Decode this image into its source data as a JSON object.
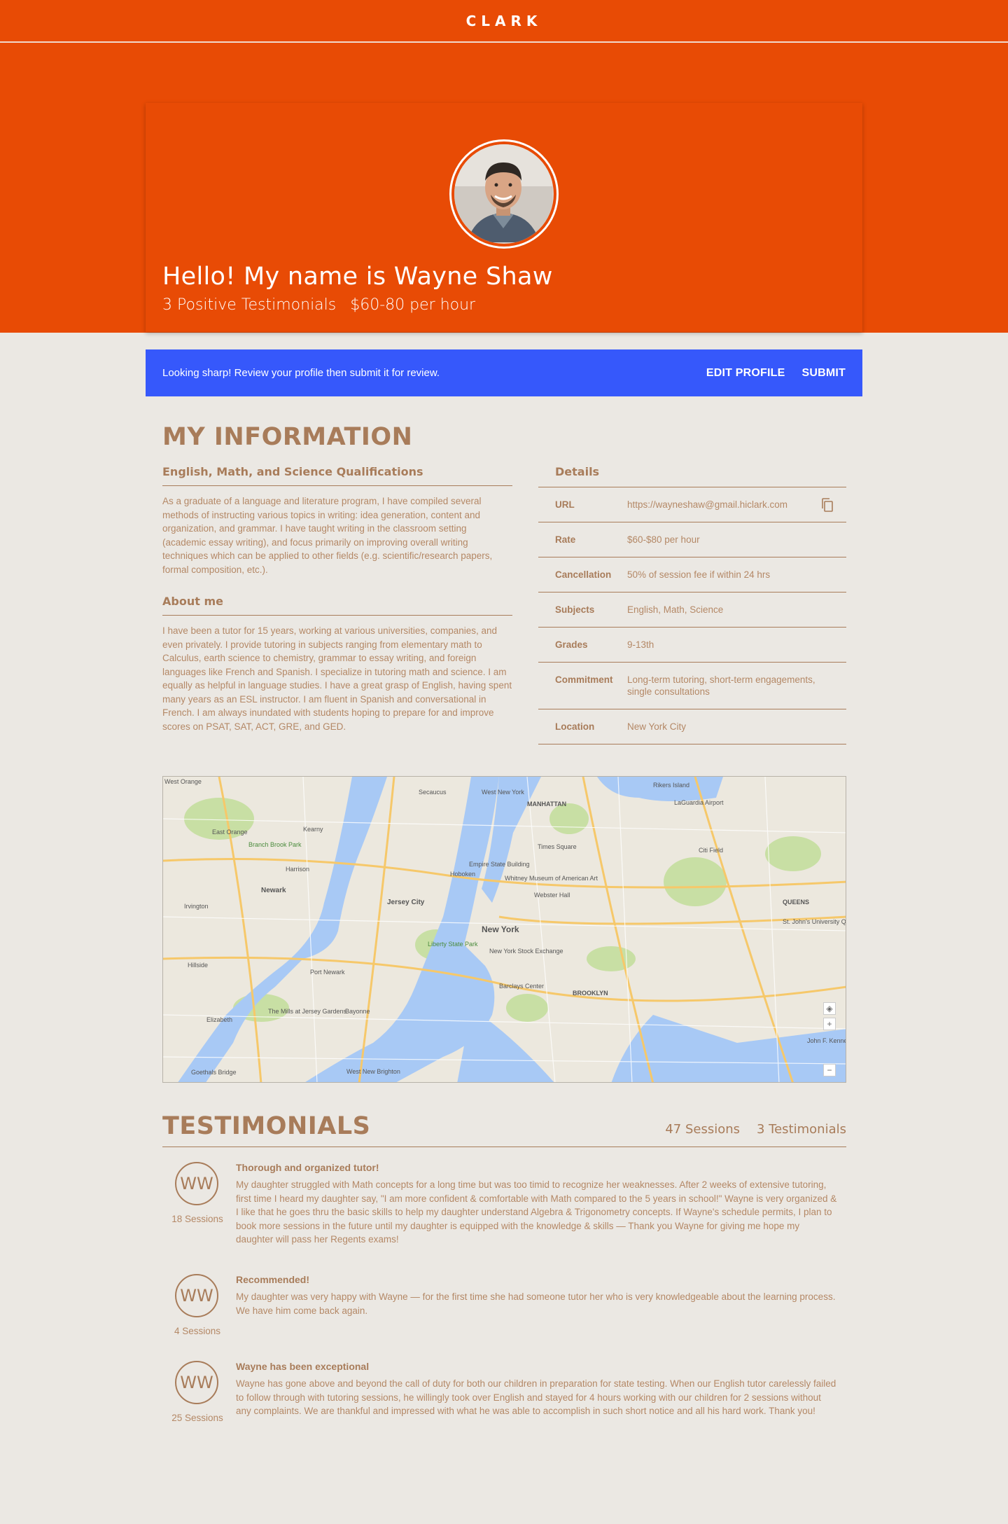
{
  "header": {
    "logo": "CLARK"
  },
  "hero": {
    "greeting": "Hello! My name is Wayne Shaw",
    "testimonials": "3 Positive Testimonials",
    "rate": "$60-80 per hour"
  },
  "banner": {
    "message": "Looking sharp! Review your profile then submit it for review.",
    "edit_label": "EDIT PROFILE",
    "submit_label": "SUBMIT",
    "color": "#3658fb"
  },
  "info": {
    "title": "MY INFORMATION",
    "qualifications_title": "English, Math, and Science Qualifications",
    "qualifications_text": "As a graduate of a language and literature program, I have compiled several methods of instructing various topics in writing: idea generation, content and organization, and grammar. I have taught writing in the classroom setting (academic essay writing), and focus primarily on improving overall writing techniques which can be applied to other fields (e.g. scientific/research papers, formal composition, etc.).",
    "about_title": "About me",
    "about_text": "I have been a tutor for 15 years, working at various universities, companies, and even privately. I provide tutoring in subjects ranging from elementary math to Calculus, earth science to chemistry, grammar to essay writing, and foreign languages like French and Spanish. I specialize in tutoring math and science. I am equally as helpful in language studies. I have a great grasp of English, having spent many years as an ESL instructor. I am fluent in Spanish and conversational in French. I am always inundated with students hoping to prepare for and improve scores on PSAT, SAT, ACT, GRE, and GED.",
    "details_title": "Details",
    "details": [
      {
        "key": "URL",
        "value": "https://wayneshaw@gmail.hiclark.com"
      },
      {
        "key": "Rate",
        "value": "$60-$80 per hour"
      },
      {
        "key": "Cancellation",
        "value": "50% of session fee if within 24 hrs"
      },
      {
        "key": "Subjects",
        "value": "English, Math, Science"
      },
      {
        "key": "Grades",
        "value": "9-13th"
      },
      {
        "key": "Commitment",
        "value": "Long-term tutoring, short-term engagements, single consultations"
      },
      {
        "key": "Location",
        "value": "New York City"
      }
    ]
  },
  "map": {
    "labels": [
      "West Orange",
      "Secaucus",
      "West New York",
      "MANHATTAN",
      "Rikers Island",
      "LaGuardia Airport",
      "East Orange",
      "Kearny",
      "Times Square",
      "Citi Field",
      "Empire State Building",
      "Hoboken",
      "Whitney Museum of American Art",
      "Newark",
      "Jersey City",
      "Webster Hall",
      "QUEENS",
      "New York",
      "St. John's University Queens Campus",
      "Liberty State Park",
      "New York Stock Exchange",
      "Hillside",
      "Port Newark",
      "Barclays Center",
      "BROOKLYN",
      "Elizabeth",
      "The Mills at Jersey Gardens",
      "Bayonne",
      "John F. Kennedy International Airport",
      "Goethals Bridge",
      "West New Brighton",
      "Irvington",
      "Harrison",
      "Branch Brook Park"
    ],
    "controls": [
      "◈",
      "+",
      "−"
    ]
  },
  "testimonials": {
    "title": "TESTIMONIALS",
    "sessions": "47 Sessions",
    "count": "3 Testimonials",
    "items": [
      {
        "initials": "WW",
        "sessions": "18 Sessions",
        "title": "Thorough and organized tutor!",
        "body": "My daughter struggled with Math concepts for a long time but was too timid to recognize her weaknesses. After 2 weeks of extensive tutoring, first time I heard my daughter say, \"I am more confident & comfortable with Math compared to the 5 years in school!\" Wayne is very organized & I like that he goes thru the basic skills to help my daughter understand Algebra & Trigonometry concepts. If Wayne's schedule permits, I plan to book more sessions in the future until my daughter is equipped with the knowledge & skills — Thank you Wayne for giving me hope my daughter will pass her Regents exams!"
      },
      {
        "initials": "WW",
        "sessions": "4 Sessions",
        "title": "Recommended!",
        "body": "My daughter was very happy with Wayne — for the first time she had someone tutor her who is very knowledgeable about the learning process. We have him come back again."
      },
      {
        "initials": "WW",
        "sessions": "25 Sessions",
        "title": "Wayne has been exceptional",
        "body": "Wayne has gone above and beyond the call of duty for both our children in preparation for state testing. When our English tutor carelessly failed to follow through with tutoring sessions, he willingly took over English and stayed for 4 hours working with our children for 2 sessions without any complaints. We are thankful and impressed with what he was able to accomplish in such short notice and all his hard work. Thank you!"
      }
    ]
  },
  "colors": {
    "brand": "#e84b05",
    "accent": "#3658fb",
    "text": "#a87c5a",
    "background": "#ebe8e3"
  }
}
